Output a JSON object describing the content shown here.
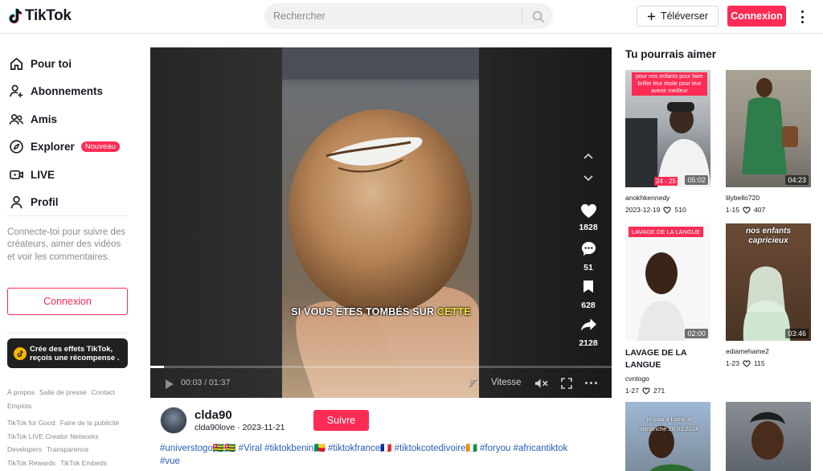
{
  "header": {
    "logo_text": "TikTok",
    "search_placeholder": "Rechercher",
    "upload_label": "Téléverser",
    "login_label": "Connexion"
  },
  "sidebar": {
    "items": [
      {
        "label": "Pour toi",
        "icon": "home-icon"
      },
      {
        "label": "Abonnements",
        "icon": "user-plus-icon"
      },
      {
        "label": "Amis",
        "icon": "users-icon"
      },
      {
        "label": "Explorer",
        "icon": "compass-icon",
        "badge": "Nouveau"
      },
      {
        "label": "LIVE",
        "icon": "live-icon"
      },
      {
        "label": "Profil",
        "icon": "profile-icon"
      }
    ],
    "login_hint": "Connecte-toi pour suivre des créateurs, aimer des vidéos et voir les commentaires.",
    "login_button": "Connexion",
    "effects_banner": "Crée des effets TikTok, reçois une récompense .",
    "footer_links_1": [
      "À propos",
      "Salle de presse",
      "Contact",
      "Emplois"
    ],
    "footer_links_2": [
      "TikTok for Good",
      "Faire de la publicité",
      "TikTok LIVE Creator Networks",
      "Developers",
      "Transparence",
      "TikTok Rewards",
      "TikTok Embeds"
    ]
  },
  "player": {
    "caption_main": "SI VOUS ÊTES TOMBÉS SUR ",
    "caption_highlight": "CETTE",
    "likes": "1828",
    "comments": "51",
    "saves": "628",
    "shares": "2128",
    "time": "00:03 / 01:37",
    "progress": 0.03,
    "speed_label": "Vitesse"
  },
  "author": {
    "name": "clda90",
    "handle_date": "clda90love · 2023-11-21",
    "follow_label": "Suivre",
    "hashtags": "#universtogo🇹🇬🇹🇬 #Viral #tiktokbenin🇧🇯 #tiktokfrance🇫🇷 #tiktokcotedivoire🇨🇮 #foryou #africantiktok #vue"
  },
  "recommendations": {
    "title": "Tu pourrais aimer",
    "cards": [
      {
        "overlay": "pour nos enfants pour faire briller leur étoile pour leur avenir meilleur",
        "badge": "24 - 25",
        "duration": "05:02",
        "user": "anokhkennedy",
        "date": "2023-12-19",
        "likes": "510",
        "title": ""
      },
      {
        "overlay": "",
        "badge": "",
        "duration": "04:23",
        "user": "lilybello720",
        "date": "1-15",
        "likes": "407",
        "title": ""
      },
      {
        "overlay": "LAVAGE DE LA LANGUE",
        "badge": "",
        "duration": "02:00",
        "user": "cvntogo",
        "date": "1-27",
        "likes": "271",
        "title": "LAVAGE DE LA LANGUE"
      },
      {
        "overlay": "nos enfants capricieux",
        "badge": "",
        "duration": "03:46",
        "user": "ediamehame2",
        "date": "1-23",
        "likes": "115",
        "title": ""
      },
      {
        "overlay": "je suis à Lomé le dimanche 28 01 2024",
        "badge": "",
        "duration": "",
        "user": "",
        "date": "",
        "likes": "",
        "title": ""
      },
      {
        "overlay": "",
        "badge": "",
        "duration": "",
        "user": "",
        "date": "",
        "likes": "",
        "title": ""
      }
    ]
  },
  "colors": {
    "accent": "#fe2c55",
    "hashtag": "#2b5db9",
    "text": "#161823",
    "muted": "#8a8b91"
  }
}
